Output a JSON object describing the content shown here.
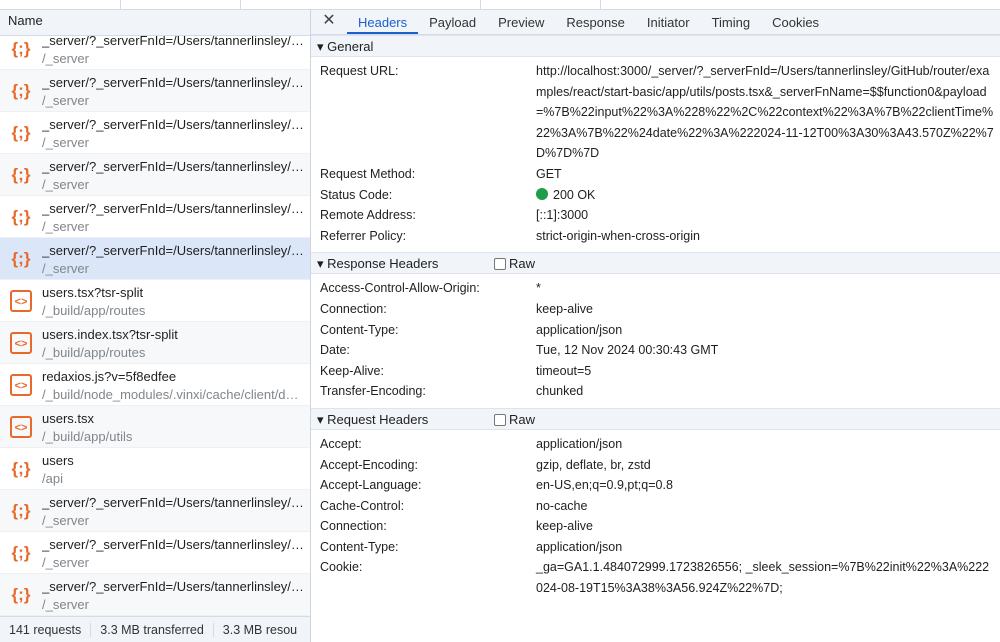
{
  "list": {
    "header": "Name",
    "requests": [
      {
        "name": "_server/?_serverFnId=/Users/tannerlinsley/GitHub/router",
        "path": "/_server",
        "type": "fetch"
      },
      {
        "name": "_server/?_serverFnId=/Users/tannerlinsley/GitHub/router",
        "path": "/_server",
        "type": "fetch"
      },
      {
        "name": "_server/?_serverFnId=/Users/tannerlinsley/GitHub/router",
        "path": "/_server",
        "type": "fetch"
      },
      {
        "name": "_server/?_serverFnId=/Users/tannerlinsley/GitHub/router",
        "path": "/_server",
        "type": "fetch"
      },
      {
        "name": "_server/?_serverFnId=/Users/tannerlinsley/GitHub/router",
        "path": "/_server",
        "type": "fetch"
      },
      {
        "name": "_server/?_serverFnId=/Users/tannerlinsley/GitHub/router",
        "path": "/_server",
        "type": "fetch",
        "selected": true
      },
      {
        "name": "users.tsx?tsr-split",
        "path": "/_build/app/routes",
        "type": "script"
      },
      {
        "name": "users.index.tsx?tsr-split",
        "path": "/_build/app/routes",
        "type": "script"
      },
      {
        "name": "redaxios.js?v=5f8edfee",
        "path": "/_build/node_modules/.vinxi/cache/client/deps",
        "type": "script"
      },
      {
        "name": "users.tsx",
        "path": "/_build/app/utils",
        "type": "script"
      },
      {
        "name": "users",
        "path": "/api",
        "type": "fetch"
      },
      {
        "name": "_server/?_serverFnId=/Users/tannerlinsley/GitHub/router",
        "path": "/_server",
        "type": "fetch"
      },
      {
        "name": "_server/?_serverFnId=/Users/tannerlinsley/GitHub/router",
        "path": "/_server",
        "type": "fetch"
      },
      {
        "name": "_server/?_serverFnId=/Users/tannerlinsley/GitHub/router",
        "path": "/_server",
        "type": "fetch"
      }
    ],
    "icons": {
      "fetch": "{;}",
      "script": "<>"
    },
    "footer": {
      "requests": "141 requests",
      "transferred": "3.3 MB transferred",
      "resources": "3.3 MB resou"
    }
  },
  "tabs": {
    "close": "✕",
    "items": [
      "Headers",
      "Payload",
      "Preview",
      "Response",
      "Initiator",
      "Timing",
      "Cookies"
    ],
    "active": "Headers"
  },
  "general": {
    "title": "General",
    "rows": [
      {
        "k": "Request URL:",
        "v": "http://localhost:3000/_server/?_serverFnId=/Users/tannerlinsley/GitHub/router/examples/react/start-basic/app/utils/posts.tsx&_serverFnName=$$function0&payload=%7B%22input%22%3A%228%22%2C%22context%22%3A%7B%22clientTime%22%3A%7B%22%24date%22%3A%222024-11-12T00%3A30%3A43.570Z%22%7D%7D%7D"
      },
      {
        "k": "Request Method:",
        "v": "GET"
      },
      {
        "k": "Status Code:",
        "v": "200 OK",
        "status": true
      },
      {
        "k": "Remote Address:",
        "v": "[::1]:3000"
      },
      {
        "k": "Referrer Policy:",
        "v": "strict-origin-when-cross-origin"
      }
    ]
  },
  "response_headers": {
    "title": "Response Headers",
    "raw_label": "Raw",
    "rows": [
      {
        "k": "Access-Control-Allow-Origin:",
        "v": "*"
      },
      {
        "k": "Connection:",
        "v": "keep-alive"
      },
      {
        "k": "Content-Type:",
        "v": "application/json"
      },
      {
        "k": "Date:",
        "v": "Tue, 12 Nov 2024 00:30:43 GMT"
      },
      {
        "k": "Keep-Alive:",
        "v": "timeout=5"
      },
      {
        "k": "Transfer-Encoding:",
        "v": "chunked"
      }
    ]
  },
  "request_headers": {
    "title": "Request Headers",
    "raw_label": "Raw",
    "rows": [
      {
        "k": "Accept:",
        "v": "application/json"
      },
      {
        "k": "Accept-Encoding:",
        "v": "gzip, deflate, br, zstd"
      },
      {
        "k": "Accept-Language:",
        "v": "en-US,en;q=0.9,pt;q=0.8"
      },
      {
        "k": "Cache-Control:",
        "v": "no-cache"
      },
      {
        "k": "Connection:",
        "v": "keep-alive"
      },
      {
        "k": "Content-Type:",
        "v": "application/json"
      },
      {
        "k": "Cookie:",
        "v": "_ga=GA1.1.484072999.1723826556; _sleek_session=%7B%22init%22%3A%222024-08-19T15%3A38%3A56.924Z%22%7D;"
      }
    ]
  },
  "colors": {
    "accent": "#1a5fd0",
    "icon": "#e8692a",
    "status_ok": "#1e9e47",
    "selected_row": "#dbe6f8"
  }
}
